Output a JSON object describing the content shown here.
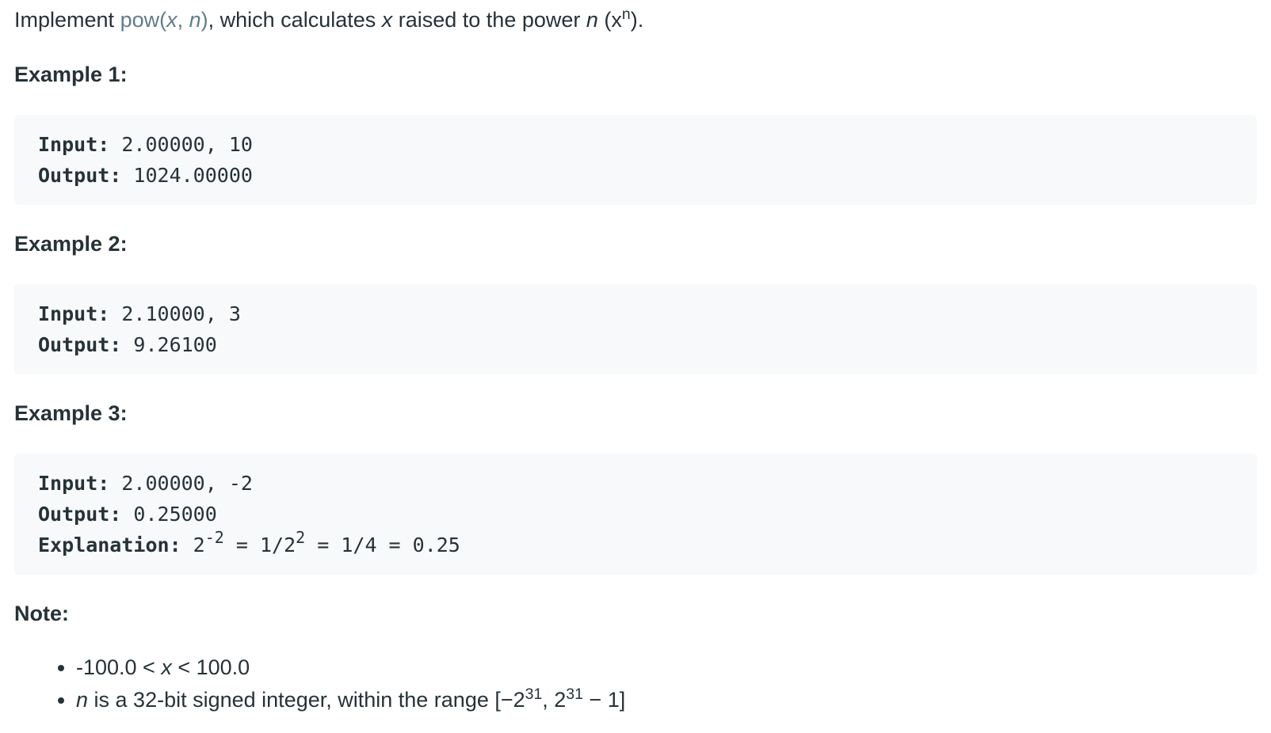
{
  "intro": {
    "prefix": "Implement ",
    "func_name": "pow(",
    "func_arg1": "x",
    "func_sep": ", ",
    "func_arg2": "n",
    "func_close": ")",
    "mid": ", which calculates ",
    "var_x": "x",
    "mid2": " raised to the power ",
    "var_n": "n",
    "paren_open": " (x",
    "sup_n": "n",
    "paren_close": ")."
  },
  "examples": [
    {
      "title": "Example 1:",
      "input_label": "Input:",
      "input_value": " 2.00000, 10",
      "output_label": "Output:",
      "output_value": " 1024.00000"
    },
    {
      "title": "Example 2:",
      "input_label": "Input:",
      "input_value": " 2.10000, 3",
      "output_label": "Output:",
      "output_value": " 9.26100"
    },
    {
      "title": "Example 3:",
      "input_label": "Input:",
      "input_value": " 2.00000, -2",
      "output_label": "Output:",
      "output_value": " 0.25000",
      "explanation_label": "Explanation:",
      "expl_base1": " 2",
      "expl_sup1": "-2",
      "expl_mid": " = 1/2",
      "expl_sup2": "2",
      "expl_rest": " = 1/4 = 0.25"
    }
  ],
  "note": {
    "title": "Note:",
    "item1": {
      "before": "-100.0 < ",
      "var": "x",
      "after": " < 100.0"
    },
    "item2": {
      "var": "n",
      "text": " is a 32-bit signed integer, within the range [−2",
      "sup1": "31",
      "mid": ", 2",
      "sup2": "31",
      "end": " − 1]"
    }
  }
}
